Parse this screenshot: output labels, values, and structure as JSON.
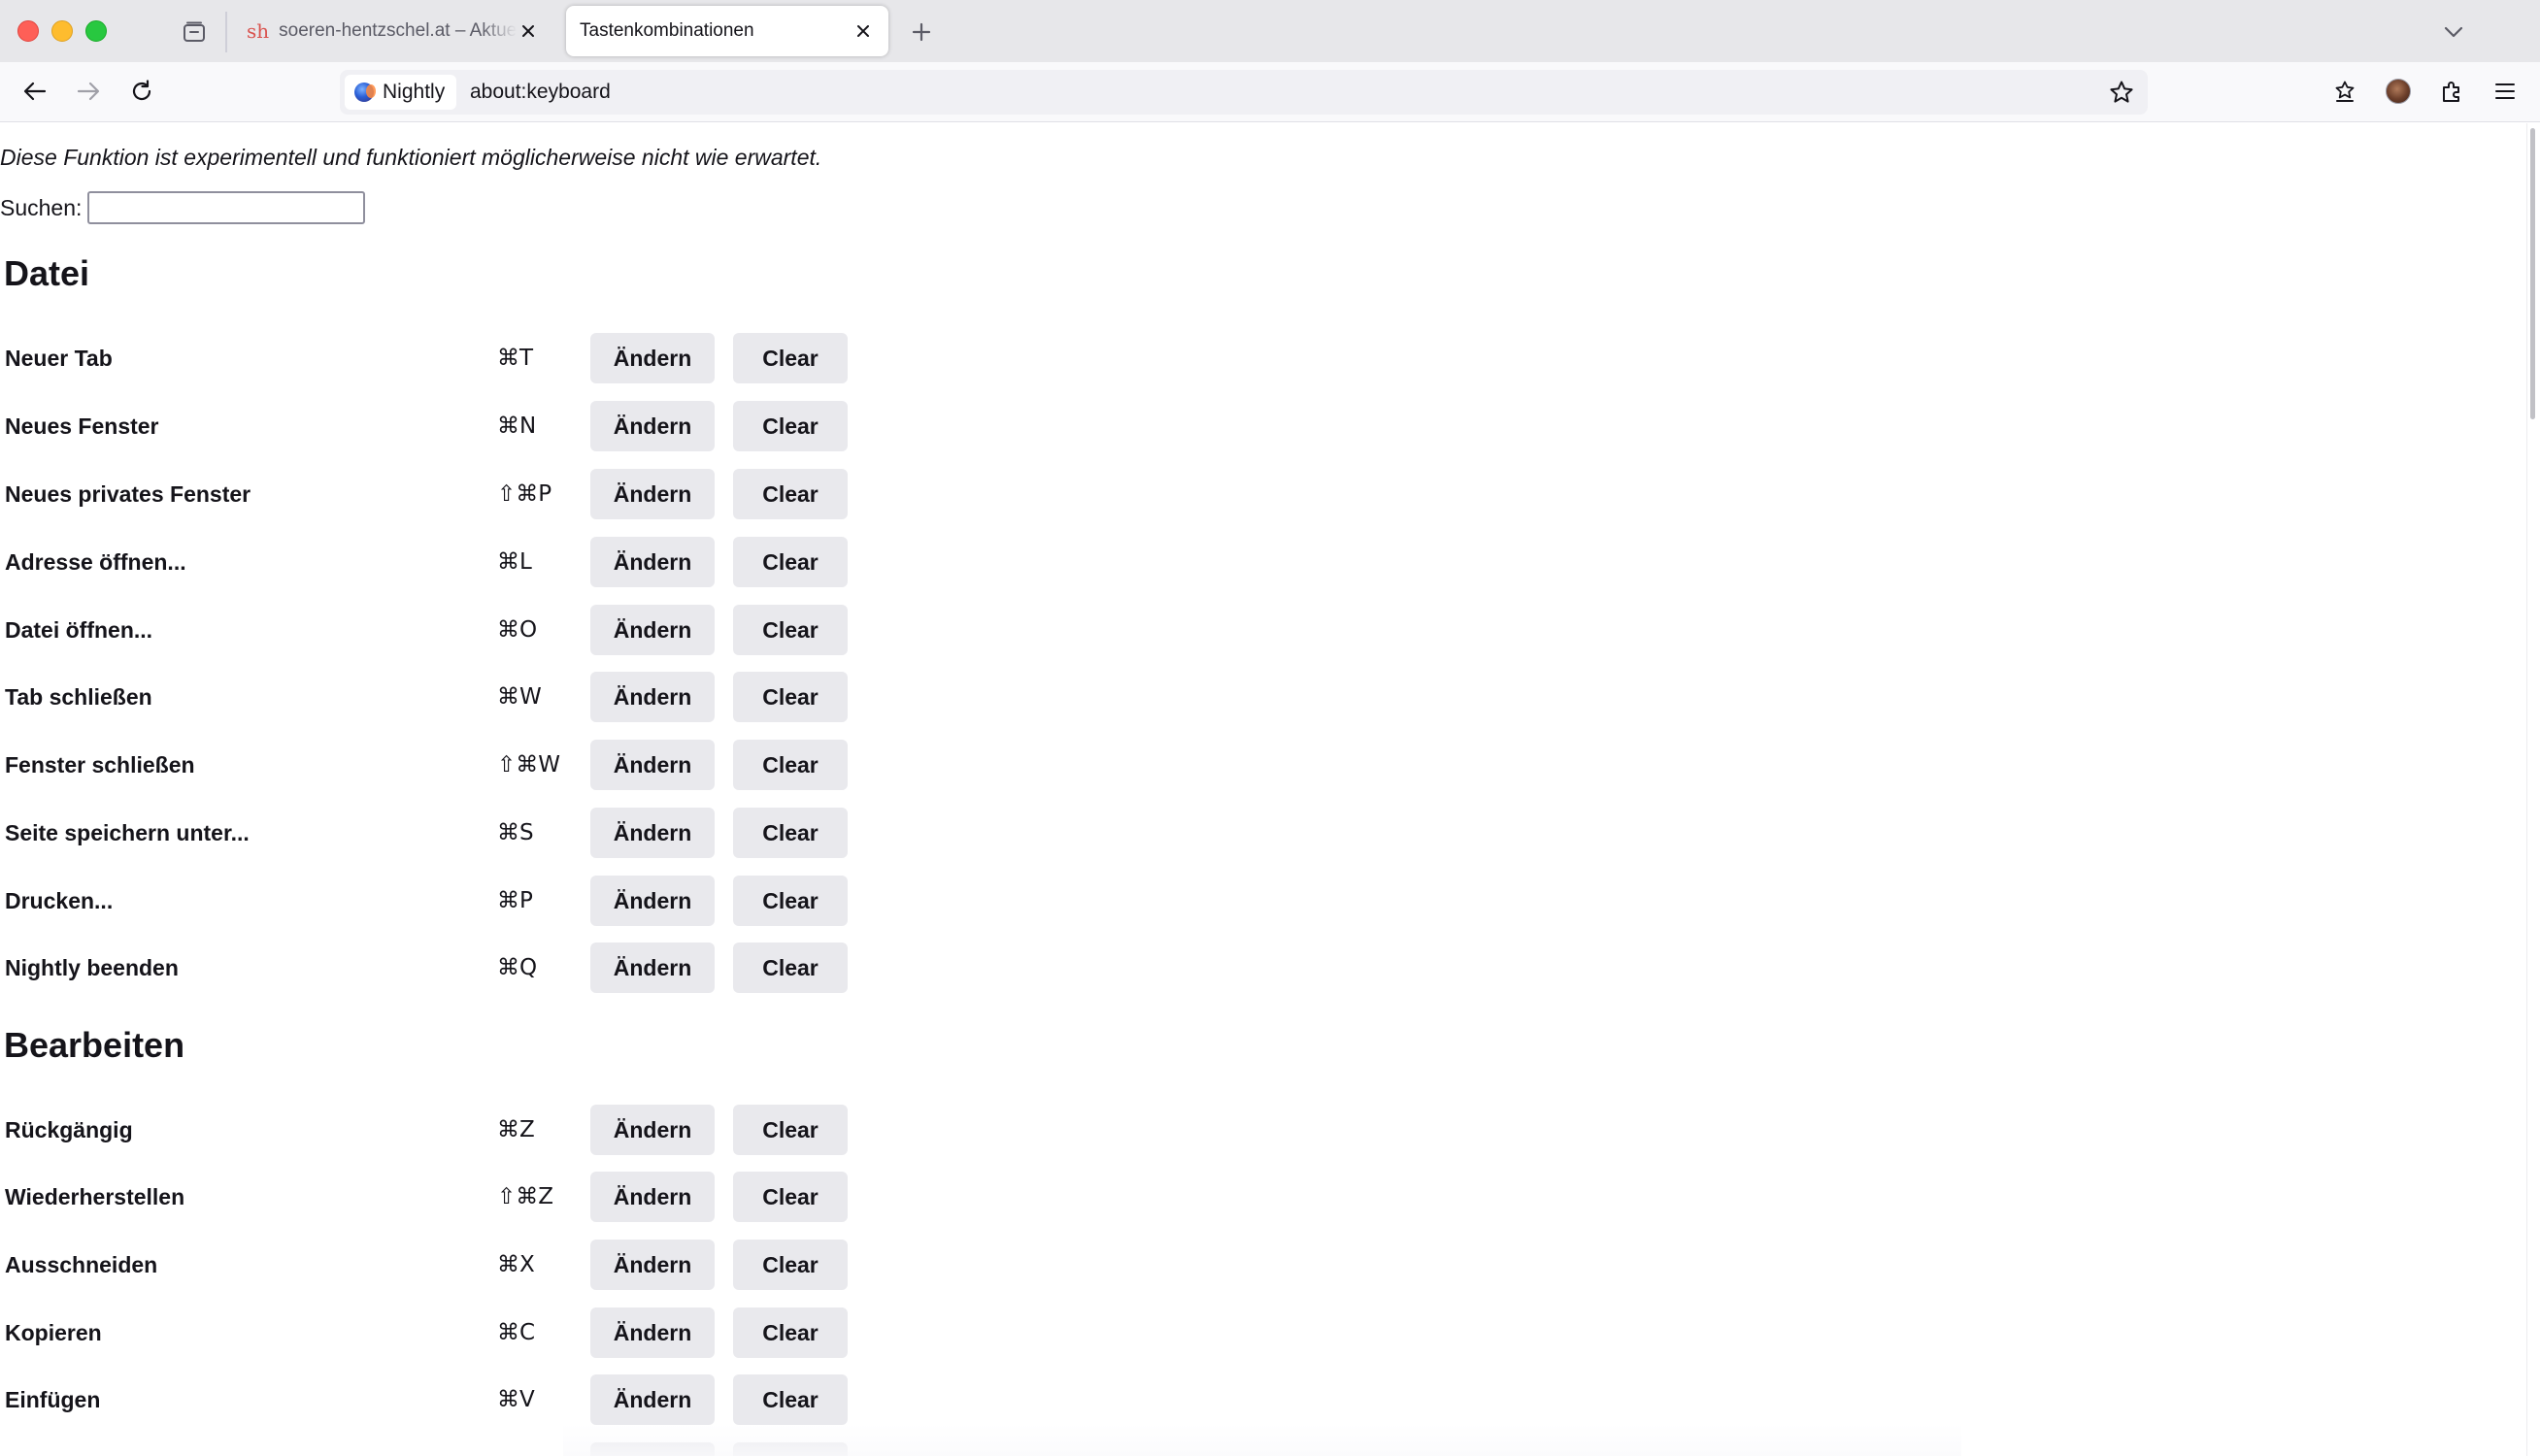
{
  "browser": {
    "tabs": [
      {
        "title": "soeren-hentzschel.at – Aktuelle",
        "favicon": "sh",
        "active": false
      },
      {
        "title": "Tastenkombinationen",
        "active": true
      }
    ],
    "identity_label": "Nightly",
    "url": "about:keyboard",
    "icons": {
      "tabview": "tab-view-icon",
      "new_tab": "plus-icon",
      "tab_list": "chevron-down-icon",
      "back": "arrow-left-icon",
      "forward": "arrow-right-icon",
      "reload": "reload-icon",
      "bookmark": "star-icon",
      "save_to_pocket": "save-icon",
      "account": "avatar",
      "extensions": "puzzle-icon",
      "menu": "hamburger-icon"
    }
  },
  "page": {
    "notice": "Diese Funktion ist experimentell und funktioniert möglicherweise nicht wie erwartet.",
    "search": {
      "label": "Suchen:",
      "value": "",
      "placeholder": ""
    },
    "change_label": "Ändern",
    "clear_label": "Clear",
    "sections": [
      {
        "title": "Datei",
        "rows": [
          {
            "label": "Neuer Tab",
            "keys": "⌘T"
          },
          {
            "label": "Neues Fenster",
            "keys": "⌘N"
          },
          {
            "label": "Neues privates Fenster",
            "keys": "⇧⌘P"
          },
          {
            "label": "Adresse öffnen...",
            "keys": "⌘L"
          },
          {
            "label": "Datei öffnen...",
            "keys": "⌘O"
          },
          {
            "label": "Tab schließen",
            "keys": "⌘W"
          },
          {
            "label": "Fenster schließen",
            "keys": "⇧⌘W"
          },
          {
            "label": "Seite speichern unter...",
            "keys": "⌘S"
          },
          {
            "label": "Drucken...",
            "keys": "⌘P"
          },
          {
            "label": "Nightly beenden",
            "keys": "⌘Q"
          }
        ]
      },
      {
        "title": "Bearbeiten",
        "rows": [
          {
            "label": "Rückgängig",
            "keys": "⌘Z"
          },
          {
            "label": "Wiederherstellen",
            "keys": "⇧⌘Z"
          },
          {
            "label": "Ausschneiden",
            "keys": "⌘X"
          },
          {
            "label": "Kopieren",
            "keys": "⌘C"
          },
          {
            "label": "Einfügen",
            "keys": "⌘V"
          }
        ]
      }
    ]
  }
}
